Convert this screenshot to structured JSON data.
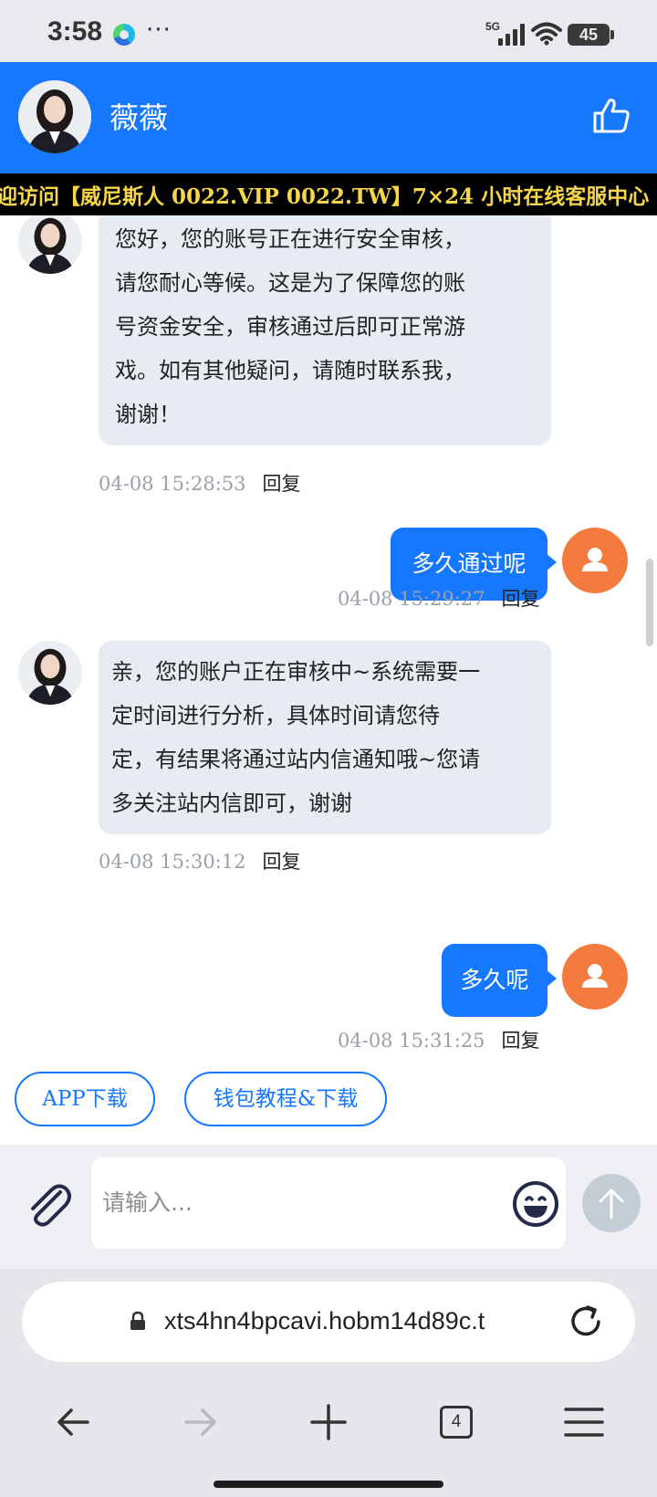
{
  "status_bar": {
    "time": "3:58",
    "more": "···",
    "network": "5G",
    "battery": "45",
    "icons": [
      "edge-browser-icon",
      "signal-icon",
      "wifi-icon",
      "battery-icon"
    ]
  },
  "header": {
    "name": "薇薇",
    "icons": [
      "agent-avatar",
      "thumbs-up-icon"
    ],
    "color": "#1677ff"
  },
  "marquee": {
    "text": "迎访问【威尼斯人 0022.VIP 0022.TW】7×24 小时在线客服中心"
  },
  "messages": [
    {
      "from": "agent",
      "lines": [
        "您好，您的账号正在进行安全审核，",
        "请您耐心等候。这是为了保障您的账",
        "号资金安全，审核通过后即可正常游",
        "戏。如有其他疑问，请随时联系我，",
        "谢谢！"
      ],
      "time": "04-08 15:28:53",
      "reply": "回复"
    },
    {
      "from": "user",
      "text": "多久通过呢",
      "time": "04-08 15:29:27",
      "reply": "回复"
    },
    {
      "from": "agent",
      "lines": [
        "亲，您的账户正在审核中~系统需要一",
        "定时间进行分析，具体时间请您待",
        "定，有结果将通过站内信通知哦~您请",
        "多关注站内信即可，谢谢"
      ],
      "time": "04-08 15:30:12",
      "reply": "回复"
    },
    {
      "from": "user",
      "text": "多久呢",
      "time": "04-08 15:31:25",
      "reply": "回复"
    }
  ],
  "quick_buttons": [
    "APP下载",
    "钱包教程&下载"
  ],
  "input": {
    "placeholder": "请输入..."
  },
  "browser": {
    "url": "xts4hn4bpcavi.hobm14d89c.t",
    "tab_count": "4"
  },
  "colors": {
    "accent": "#1677ff",
    "agent_bubble": "#e7ebf2",
    "user_avatar": "#f47a3d",
    "marquee_text": "#f5d54a"
  }
}
